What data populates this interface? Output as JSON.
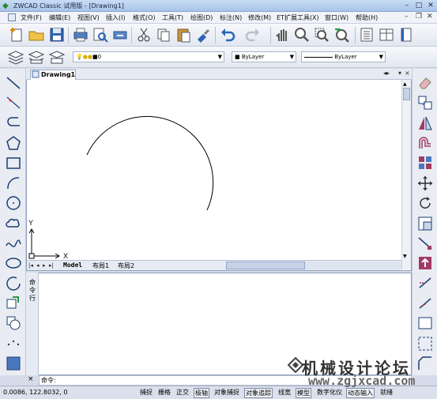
{
  "window": {
    "title": "ZWCAD Classic 试用版 - [Drawing1]"
  },
  "menu": {
    "items": [
      "文件(F)",
      "编辑(E)",
      "视图(V)",
      "插入(I)",
      "格式(O)",
      "工具(T)",
      "绘图(D)",
      "标注(N)",
      "修改(M)",
      "ET扩展工具(X)",
      "窗口(W)",
      "帮助(H)"
    ]
  },
  "layer_toolbar": {
    "layer_value": "0",
    "color_value": "ByLayer",
    "linetype_value": "ByLayer"
  },
  "drawing": {
    "tab_label": "Drawing1",
    "ucs": {
      "x_label": "X",
      "y_label": "Y"
    }
  },
  "layout_tabs": [
    "Model",
    "布局1",
    "布局2"
  ],
  "command": {
    "side_label": "命令行",
    "prompt": "命令:",
    "close_glyph": "×"
  },
  "status": {
    "coords": "0.0086,  122.8032,  0",
    "buttons": [
      "捕捉",
      "栅格",
      "正交",
      "极轴",
      "对象捕捉",
      "对象追踪",
      "线宽",
      "模型",
      "数字化仪",
      "动态输入",
      "就绪"
    ]
  },
  "watermark": {
    "chinese": "机械设计论坛",
    "url": "www.zgjxcad.com"
  },
  "colors": {
    "accent": "#2a64b8",
    "canvas": "#ffffff",
    "chrome": "#d6dbe9"
  }
}
